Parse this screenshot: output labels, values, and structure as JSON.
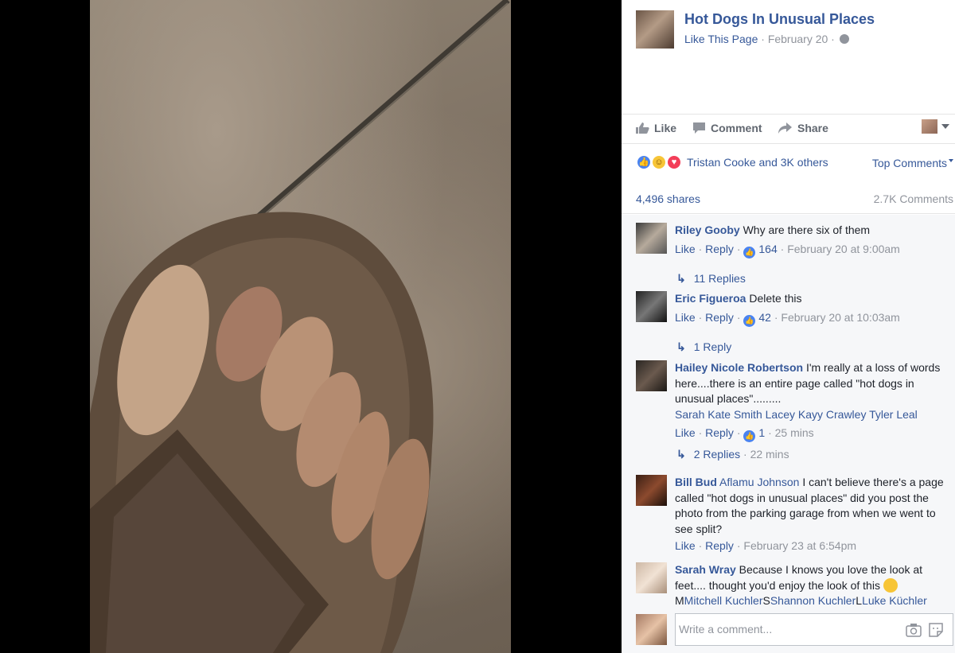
{
  "post": {
    "page_name": "Hot Dogs In Unusual Places",
    "like_page": "Like This Page",
    "date": "February 20",
    "separator": " · "
  },
  "actions": {
    "like": "Like",
    "comment": "Comment",
    "share": "Share"
  },
  "reactions": {
    "summary": "Tristan Cooke and 3K others",
    "sort_label": "Top Comments",
    "icons": [
      "like-reaction-icon",
      "haha-reaction-icon",
      "love-reaction-icon"
    ]
  },
  "stats": {
    "shares": "4,496 shares",
    "comments": "2.7K Comments"
  },
  "comments": [
    {
      "author": "Riley Gooby",
      "text": "Why are there six of them",
      "like": "Like",
      "reply": "Reply",
      "likes": "164",
      "time": "February 20 at 9:00am",
      "replies": "11 Replies"
    },
    {
      "author": "Eric Figueroa",
      "text": "Delete this",
      "like": "Like",
      "reply": "Reply",
      "likes": "42",
      "time": "February 20 at 10:03am",
      "replies": "1 Reply"
    },
    {
      "author": "Hailey Nicole Robertson",
      "text": "I'm really at a loss of words here....there is an entire page called \"hot dogs in unusual places\".........",
      "mentions": [
        "Sarah Kate Smith",
        "Lacey Kayy Crawley",
        "Tyler Leal"
      ],
      "like": "Like",
      "reply": "Reply",
      "likes": "1",
      "time": "25 mins",
      "replies": "2 Replies",
      "replies_time": "22 mins"
    },
    {
      "author": "Bill Bud",
      "mention": "Aflamu Johnson",
      "text": "I can't believe there's a page called \"hot dogs in unusual places\" did you post the photo from the parking garage from when we went to see split?",
      "like": "Like",
      "reply": "Reply",
      "time": "February 23 at 6:54pm"
    },
    {
      "author": "Sarah Wray",
      "text": "Because I knows you love the look at feet.... thought you'd enjoy the look of this",
      "tags": [
        "M",
        "Mitchell Kuchler",
        "S",
        "Shannon Kuchler",
        "L",
        "Luke Küchler"
      ]
    }
  ],
  "composer": {
    "placeholder": "Write a comment..."
  },
  "colors": {
    "link": "#365899",
    "muted": "#90949c",
    "like_blue": "#4a83f0",
    "love_red": "#f33e58",
    "haha_yellow": "#f7c537"
  }
}
